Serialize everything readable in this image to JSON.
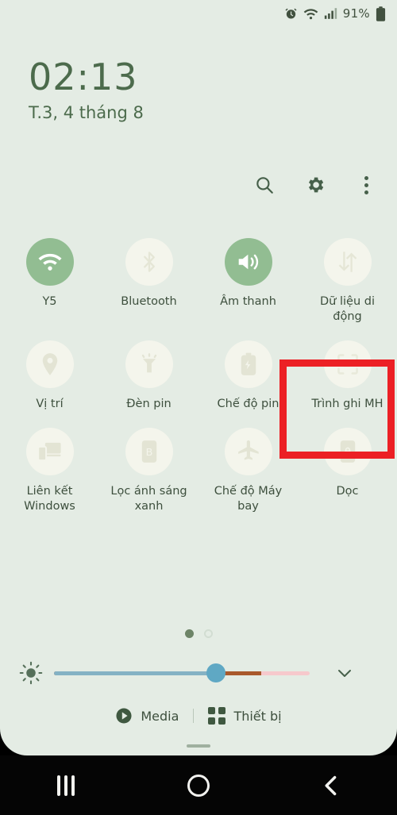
{
  "statusbar": {
    "icons": [
      "alarm-icon",
      "wifi-icon",
      "signal-icon"
    ],
    "battery_percent": "91%",
    "battery_icon": "battery-icon"
  },
  "clock": {
    "time": "02:13",
    "date": "T.3, 4 tháng 8"
  },
  "header": {
    "search_label": "search-icon",
    "settings_label": "gear-icon",
    "more_label": "more-options-icon"
  },
  "tiles": [
    {
      "id": "wifi",
      "label": "Y5",
      "icon": "wifi-icon",
      "active": true
    },
    {
      "id": "bluetooth",
      "label": "Bluetooth",
      "icon": "bluetooth-icon",
      "active": false
    },
    {
      "id": "sound",
      "label": "Âm thanh",
      "icon": "volume-icon",
      "active": true
    },
    {
      "id": "mobiledata",
      "label": "Dữ liệu di động",
      "icon": "data-transfer-icon",
      "active": false
    },
    {
      "id": "location",
      "label": "Vị trí",
      "icon": "location-pin-icon",
      "active": false
    },
    {
      "id": "flashlight",
      "label": "Đèn pin",
      "icon": "flashlight-icon",
      "active": false
    },
    {
      "id": "powersaving",
      "label": "Chế độ pin",
      "icon": "battery-saver-icon",
      "active": false
    },
    {
      "id": "screenrec",
      "label": "Trình ghi MH",
      "icon": "screen-recorder-icon",
      "active": false
    },
    {
      "id": "linkwindows",
      "label": "Liên kết Windows",
      "icon": "link-windows-icon",
      "active": false
    },
    {
      "id": "bluelight",
      "label": "Lọc ánh sáng xanh",
      "icon": "blue-light-icon",
      "active": false
    },
    {
      "id": "airplane",
      "label": "Chế độ Máy bay",
      "icon": "airplane-icon",
      "active": false
    },
    {
      "id": "rotation",
      "label": "Dọc",
      "icon": "rotation-lock-icon",
      "active": false
    }
  ],
  "pager": {
    "total": 2,
    "current": 1
  },
  "brightness": {
    "icon": "brightness-icon",
    "value_percent": 60,
    "expand_icon": "chevron-down-icon"
  },
  "footer": {
    "media_label": "Media",
    "media_icon": "play-circle-icon",
    "devices_label": "Thiết bị",
    "devices_icon": "grid-squares-icon"
  },
  "navbar": {
    "recents_label": "recents-icon",
    "home_label": "home-icon",
    "back_label": "back-icon"
  },
  "annotation": {
    "target_tile": "Trình ghi MH",
    "color": "#ec2025"
  },
  "colors": {
    "background": "#e4ece4",
    "tile_active": "#92bd92",
    "tile_inactive": "#f4f5ec",
    "text": "#3d4f3d",
    "clock_text": "#4c6b4c",
    "annotation_red": "#ec2025"
  }
}
